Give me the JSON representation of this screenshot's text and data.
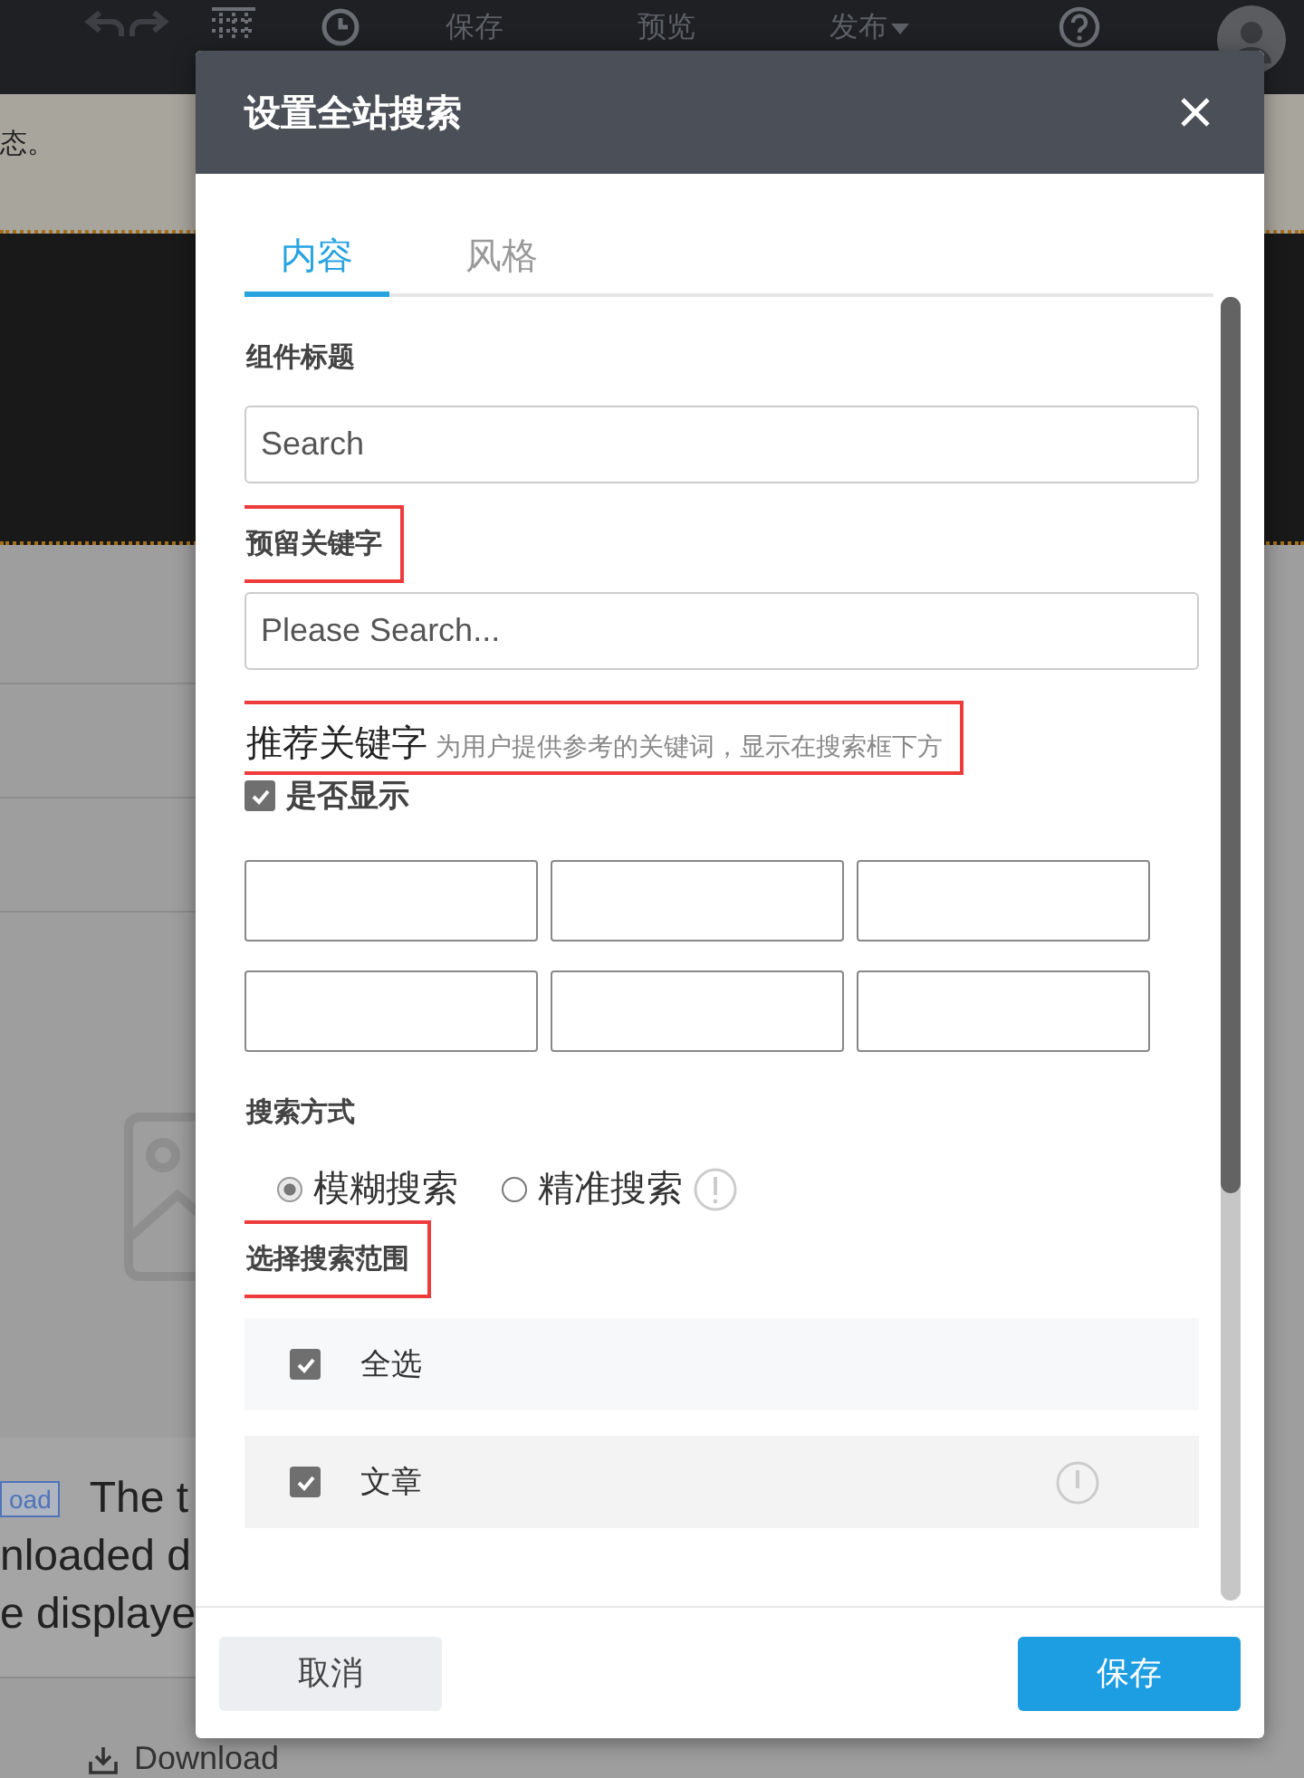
{
  "toolbar": {
    "labels": [
      {
        "text": "保存",
        "caret": false
      },
      {
        "text": "预览",
        "caret": false
      },
      {
        "text": "发布",
        "caret": true
      }
    ]
  },
  "notice": {
    "text": "态。"
  },
  "background_card": {
    "tag": "oad",
    "lines": [
      "The t",
      "nloaded d",
      "e displaye"
    ],
    "download": "Download"
  },
  "dialog": {
    "title": "设置全站搜索",
    "tabs": [
      {
        "label": "内容",
        "selected": true
      },
      {
        "label": "风格",
        "selected": false
      }
    ],
    "title_field": {
      "label": "组件标题",
      "value": "Search",
      "highlighted": false
    },
    "reserved_field": {
      "label": "预留关键字",
      "placeholder": "Please Search...",
      "highlighted": true
    },
    "recommended": {
      "label": "推荐关键字",
      "hint": "为用户提供参考的关键词，显示在搜索框下方",
      "highlighted": true,
      "show": {
        "label": "是否显示",
        "checked": true
      }
    },
    "search_mode": {
      "label": "搜索方式",
      "highlighted": false,
      "options": [
        {
          "label": "模糊搜索",
          "selected": true,
          "info": false
        },
        {
          "label": "精准搜索",
          "selected": false,
          "info": true
        }
      ]
    },
    "scope": {
      "label": "选择搜索范围",
      "highlighted": true,
      "items": [
        {
          "label": "全选",
          "checked": true,
          "info": false
        },
        {
          "label": "文章",
          "checked": true,
          "info": true
        }
      ]
    },
    "buttons": {
      "cancel": "取消",
      "save": "保存"
    }
  }
}
